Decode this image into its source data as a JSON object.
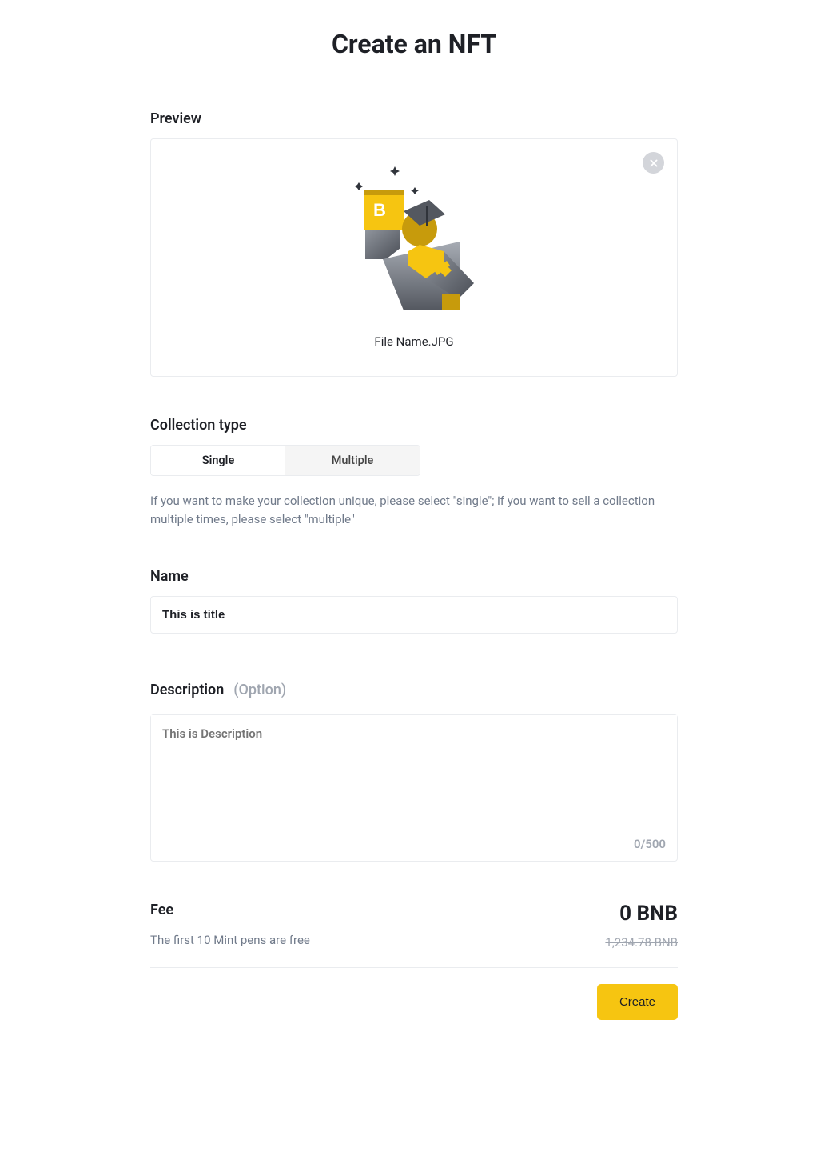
{
  "page_title": "Create an NFT",
  "preview": {
    "label": "Preview",
    "file_name": "File Name.JPG"
  },
  "collection_type": {
    "label": "Collection type",
    "options": [
      "Single",
      "Multiple"
    ],
    "selected_index": 0,
    "help": "If you want to make your collection unique, please select \"single\"; if you want to sell a collection multiple times, please select \"multiple\""
  },
  "name_field": {
    "label": "Name",
    "placeholder": "This is title"
  },
  "description_field": {
    "label": "Description",
    "option_tag": "(Option)",
    "placeholder": "This is Description",
    "char_count": "0/500"
  },
  "fee": {
    "label": "Fee",
    "note": "The first 10 Mint pens are free",
    "amount": "0 BNB",
    "original": "1,234.78 BNB"
  },
  "actions": {
    "create_label": "Create"
  }
}
